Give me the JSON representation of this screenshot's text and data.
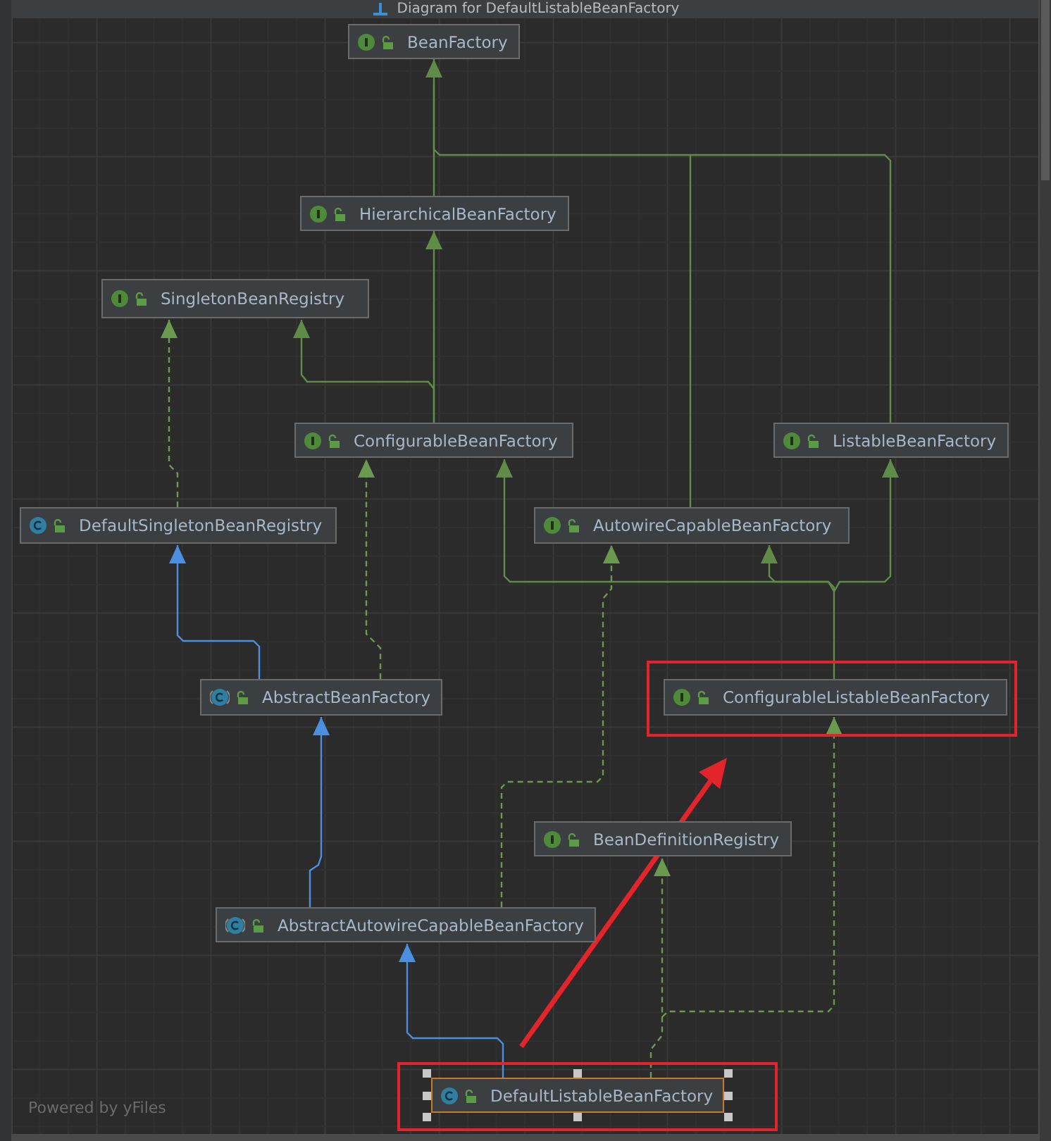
{
  "window": {
    "title": "Diagram for DefaultListableBeanFactory"
  },
  "nodes": [
    {
      "name": "BeanFactory",
      "kind": "interface",
      "selected": false,
      "highlighted": false
    },
    {
      "name": "HierarchicalBeanFactory",
      "kind": "interface",
      "selected": false,
      "highlighted": false
    },
    {
      "name": "SingletonBeanRegistry",
      "kind": "interface",
      "selected": false,
      "highlighted": false
    },
    {
      "name": "ConfigurableBeanFactory",
      "kind": "interface",
      "selected": false,
      "highlighted": false
    },
    {
      "name": "ListableBeanFactory",
      "kind": "interface",
      "selected": false,
      "highlighted": false
    },
    {
      "name": "DefaultSingletonBeanRegistry",
      "kind": "class",
      "selected": false,
      "highlighted": false
    },
    {
      "name": "AutowireCapableBeanFactory",
      "kind": "interface",
      "selected": false,
      "highlighted": false
    },
    {
      "name": "AbstractBeanFactory",
      "kind": "abstract",
      "selected": false,
      "highlighted": false
    },
    {
      "name": "ConfigurableListableBeanFactory",
      "kind": "interface",
      "selected": false,
      "highlighted": true
    },
    {
      "name": "BeanDefinitionRegistry",
      "kind": "interface",
      "selected": false,
      "highlighted": false
    },
    {
      "name": "AbstractAutowireCapableBeanFactory",
      "kind": "abstract",
      "selected": false,
      "highlighted": false
    },
    {
      "name": "DefaultListableBeanFactory",
      "kind": "class",
      "selected": true,
      "highlighted": true
    }
  ],
  "footer": "Powered by yFiles"
}
